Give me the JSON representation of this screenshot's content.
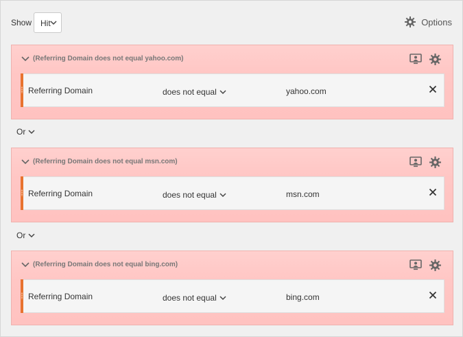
{
  "header": {
    "show_label": "Show",
    "show_value": "Hit",
    "options_label": "Options"
  },
  "containers": [
    {
      "title": "(Referring Domain does not equal yahoo.com)",
      "rule": {
        "field": "Referring Domain",
        "operator": "does not equal",
        "value": "yahoo.com"
      }
    },
    {
      "title": "(Referring Domain does not equal msn.com)",
      "rule": {
        "field": "Referring Domain",
        "operator": "does not equal",
        "value": "msn.com"
      }
    },
    {
      "title": "(Referring Domain does not equal bing.com)",
      "rule": {
        "field": "Referring Domain",
        "operator": "does not equal",
        "value": "bing.com"
      }
    }
  ],
  "connectors": [
    "Or",
    "Or"
  ],
  "colors": {
    "container_bg": "#ffc6c4",
    "rule_accent": "#e8732f",
    "icon_gray": "#666666"
  },
  "icons": {
    "collapse": "chevron-down-icon",
    "screen": "monitor-user-icon",
    "settings": "gear-icon",
    "remove": "close-icon"
  }
}
